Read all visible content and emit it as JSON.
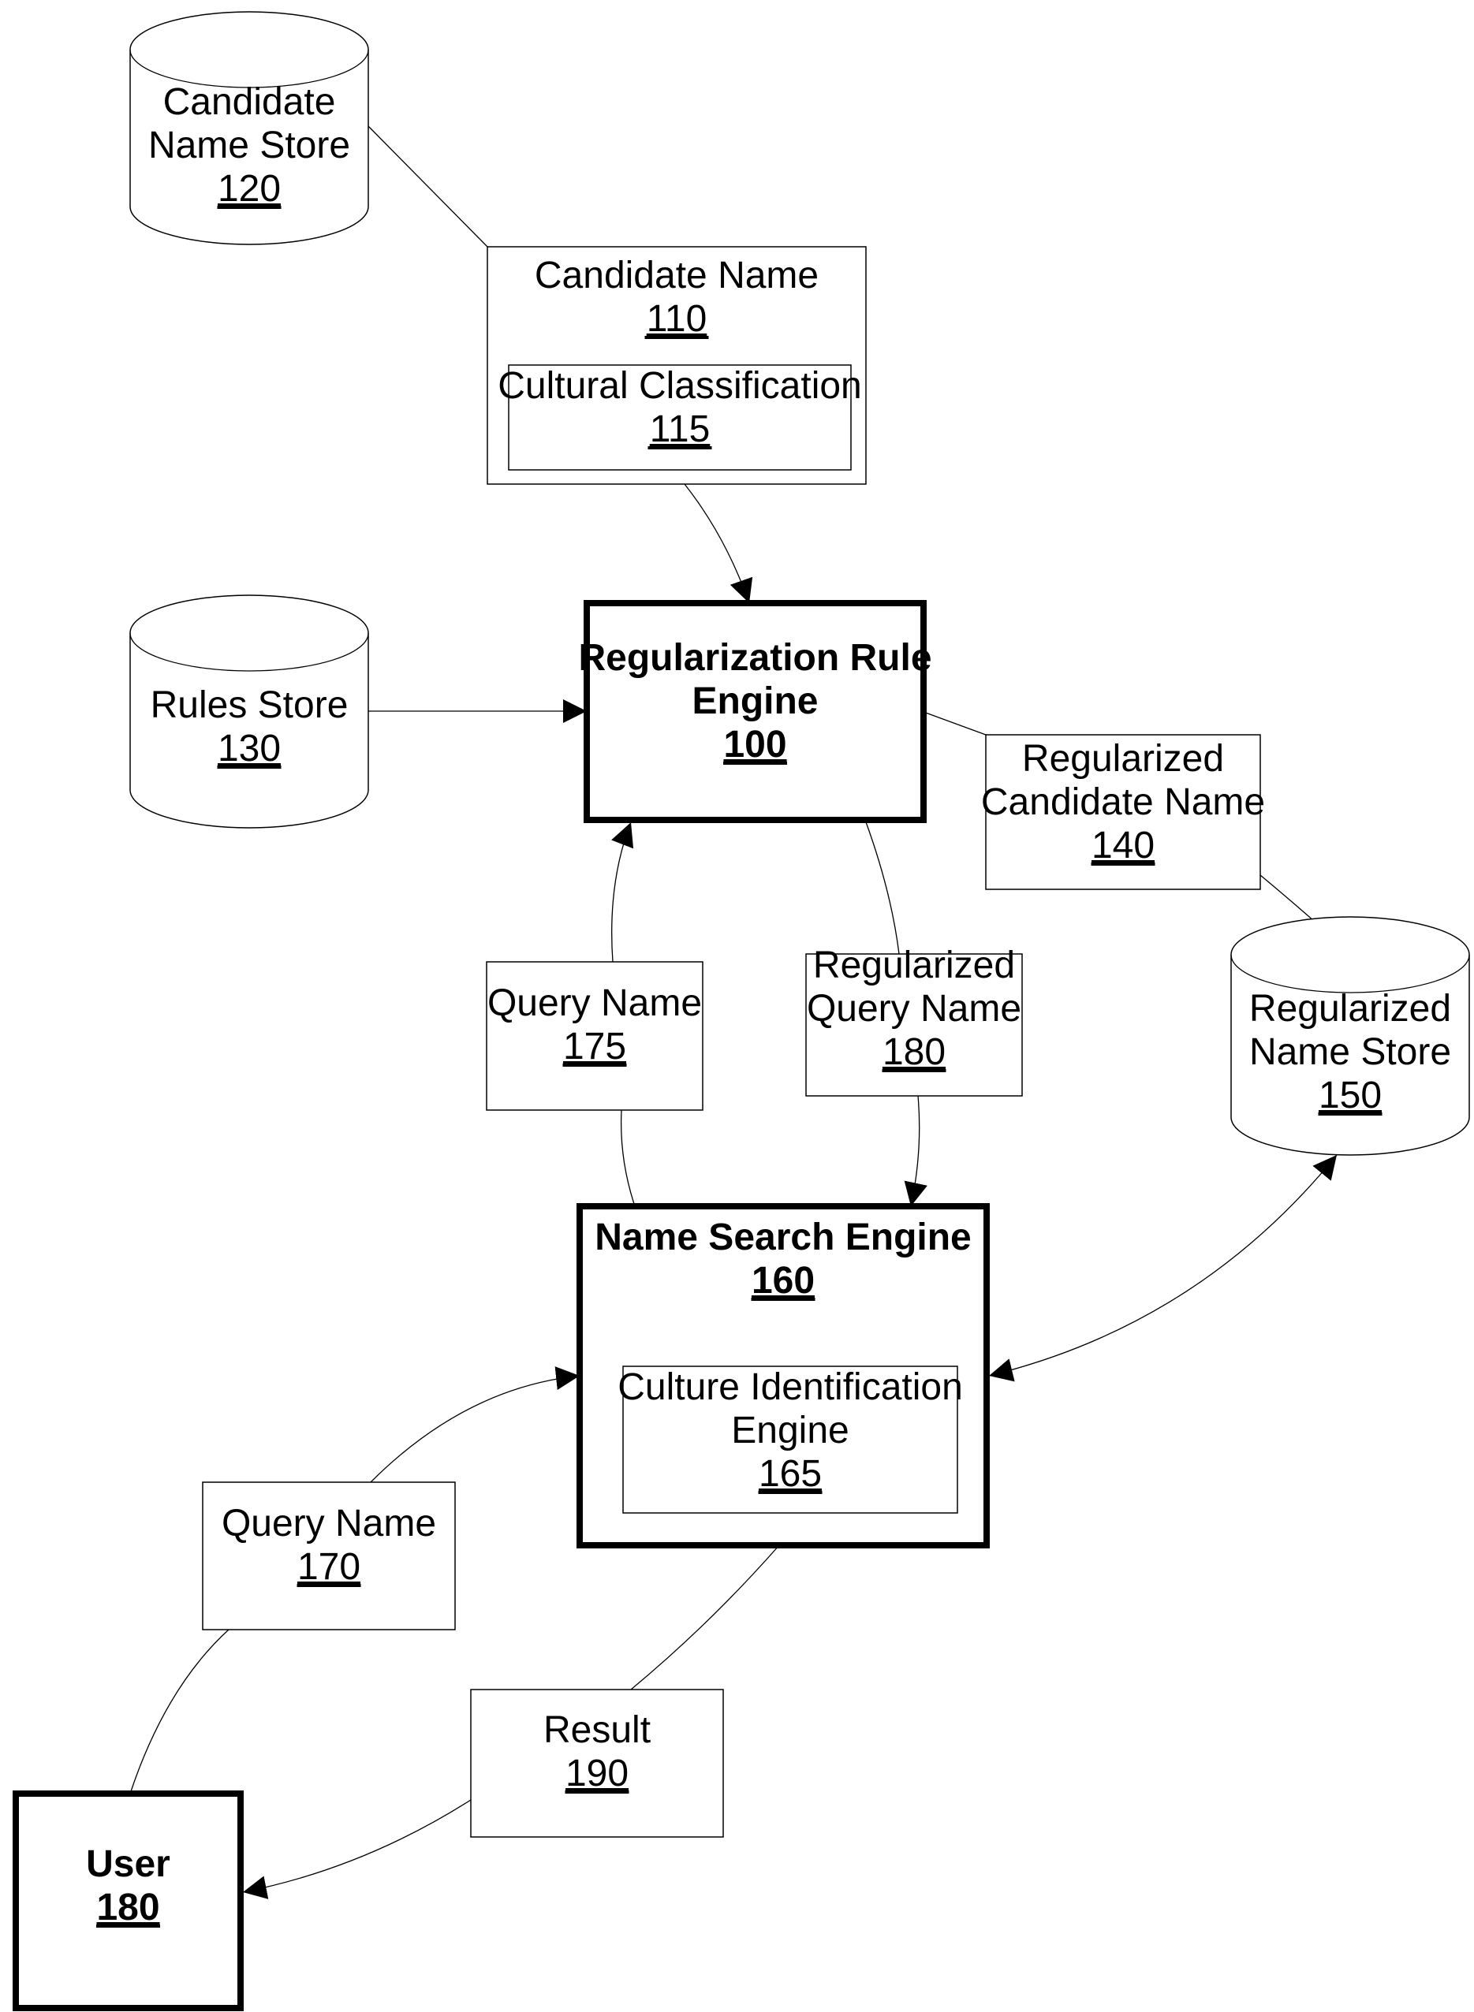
{
  "diagram": {
    "nodes": {
      "candidate_name_store": {
        "type": "datastore",
        "lines": [
          "Candidate",
          "Name Store"
        ],
        "ref": "120"
      },
      "candidate_name": {
        "type": "data",
        "lines": [
          "Candidate Name"
        ],
        "ref": "110"
      },
      "cultural_classification": {
        "type": "data",
        "lines": [
          "Cultural Classification"
        ],
        "ref": "115"
      },
      "rules_store": {
        "type": "datastore",
        "lines": [
          "Rules Store"
        ],
        "ref": "130"
      },
      "regularization_rule_engine": {
        "type": "component",
        "lines": [
          "Regularization Rule",
          "Engine"
        ],
        "ref": "100"
      },
      "regularized_candidate_name": {
        "type": "data",
        "lines": [
          "Regularized",
          "Candidate Name"
        ],
        "ref": "140"
      },
      "regularized_name_store": {
        "type": "datastore",
        "lines": [
          "Regularized",
          "Name Store"
        ],
        "ref": "150"
      },
      "query_name_175": {
        "type": "data",
        "lines": [
          "Query Name"
        ],
        "ref": "175"
      },
      "regularized_query_name": {
        "type": "data",
        "lines": [
          "Regularized",
          "Query Name"
        ],
        "ref": "180"
      },
      "name_search_engine": {
        "type": "component",
        "lines": [
          "Name Search Engine"
        ],
        "ref": "160"
      },
      "culture_identification_engine": {
        "type": "component",
        "lines": [
          "Culture Identification",
          "Engine"
        ],
        "ref": "165"
      },
      "query_name_170": {
        "type": "data",
        "lines": [
          "Query Name"
        ],
        "ref": "170"
      },
      "result": {
        "type": "data",
        "lines": [
          "Result"
        ],
        "ref": "190"
      },
      "user": {
        "type": "actor",
        "lines": [
          "User"
        ],
        "ref": "180"
      }
    },
    "edges": [
      {
        "from": "candidate_name_store",
        "to": "regularization_rule_engine",
        "via": "candidate_name",
        "arrow": "end"
      },
      {
        "from": "rules_store",
        "to": "regularization_rule_engine",
        "arrow": "end"
      },
      {
        "from": "regularization_rule_engine",
        "to": "regularized_name_store",
        "via": "regularized_candidate_name",
        "arrow": "end"
      },
      {
        "from": "name_search_engine",
        "to": "regularization_rule_engine",
        "via": "query_name_175",
        "arrow": "end"
      },
      {
        "from": "regularization_rule_engine",
        "to": "name_search_engine",
        "via": "regularized_query_name",
        "arrow": "end"
      },
      {
        "from": "regularized_name_store",
        "to": "name_search_engine",
        "arrow": "both"
      },
      {
        "from": "user",
        "to": "name_search_engine",
        "via": "query_name_170",
        "arrow": "end"
      },
      {
        "from": "name_search_engine",
        "to": "user",
        "via": "result",
        "arrow": "end"
      }
    ]
  }
}
